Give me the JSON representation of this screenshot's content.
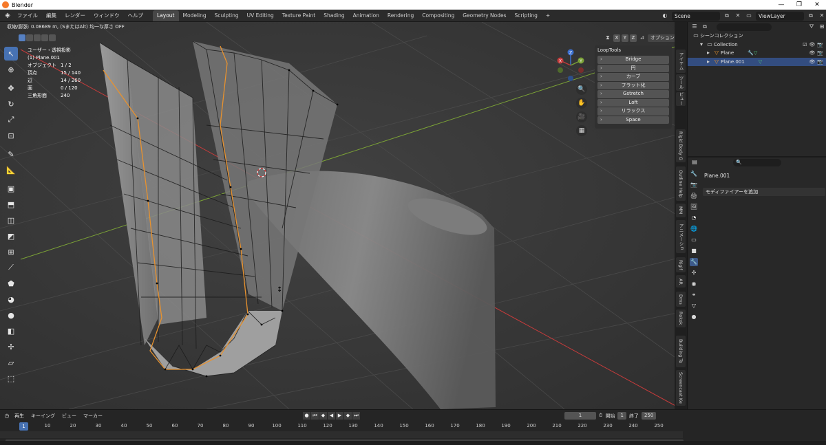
{
  "window": {
    "title": "Blender",
    "controls": [
      "—",
      "❐",
      "✕"
    ]
  },
  "menubar": {
    "menus": [
      "ファイル",
      "編集",
      "レンダー",
      "ウィンドウ",
      "ヘルプ"
    ],
    "workspaces": [
      "Layout",
      "Modeling",
      "Sculpting",
      "UV Editing",
      "Texture Paint",
      "Shading",
      "Animation",
      "Rendering",
      "Compositing",
      "Geometry Nodes",
      "Scripting",
      "+"
    ],
    "active_workspace": "Layout",
    "scene": "Scene",
    "view_layer": "ViewLayer"
  },
  "viewport": {
    "header_text": "収縮/膨張: 0.08689 m, (SまたはAlt) 均一な厚さ OFF",
    "stats": {
      "mode": "ユーザー・透視投影",
      "object": "(1) Plane.001",
      "rows": [
        {
          "k": "オブジェクト",
          "v": "1 / 2"
        },
        {
          "k": "頂点",
          "v": "15 / 140"
        },
        {
          "k": "辺",
          "v": "14 / 260"
        },
        {
          "k": "面",
          "v": "0 / 120"
        },
        {
          "k": "三角形面",
          "v": "240"
        }
      ]
    },
    "axis_buttons": [
      "X",
      "Y",
      "Z"
    ],
    "options_label": "オプション ⌄",
    "gizmo_labels": {
      "z": "Z",
      "x": "X",
      "y": "Y"
    },
    "colors": {
      "x_axis": "#c53b3b",
      "y_axis": "#7ba236",
      "z_axis": "#3b6fcf",
      "selected_edge": "#e8922e"
    }
  },
  "looptools": {
    "header": "LoopTools",
    "buttons": [
      "Bridge",
      "円",
      "カーブ",
      "フラット化",
      "Gstretch",
      "Loft",
      "リラックス",
      "Space"
    ]
  },
  "sidetabs": [
    "アイテム",
    "ツール",
    "ビュー",
    "Rigid Body G",
    "Outline Help",
    "MM",
    "アニメーショ",
    "Rigif",
    "AR",
    "Dms",
    "Rokok",
    "Building To",
    "Screencast Ke"
  ],
  "outliner": {
    "search_placeholder": "",
    "rows": [
      {
        "label": "シーンコレクション",
        "indent": 0,
        "selected": false
      },
      {
        "label": "Collection",
        "indent": 1,
        "selected": false
      },
      {
        "label": "Plane",
        "indent": 2,
        "selected": false
      },
      {
        "label": "Plane.001",
        "indent": 2,
        "selected": true
      }
    ]
  },
  "properties": {
    "object_name": "Plane.001",
    "add_modifier": "モディファイアーを追加"
  },
  "timeline": {
    "menus": [
      "再生",
      "キーイング",
      "ビュー",
      "マーカー"
    ],
    "current_frame": "1",
    "start_label": "開始",
    "start": "1",
    "end_label": "終了",
    "end": "250",
    "ruler": [
      "10",
      "20",
      "30",
      "40",
      "50",
      "60",
      "70",
      "80",
      "90",
      "100",
      "110",
      "120",
      "130",
      "140",
      "150",
      "160",
      "170",
      "180",
      "190",
      "200",
      "210",
      "220",
      "230",
      "240",
      "250"
    ],
    "cursor_label": "1"
  }
}
